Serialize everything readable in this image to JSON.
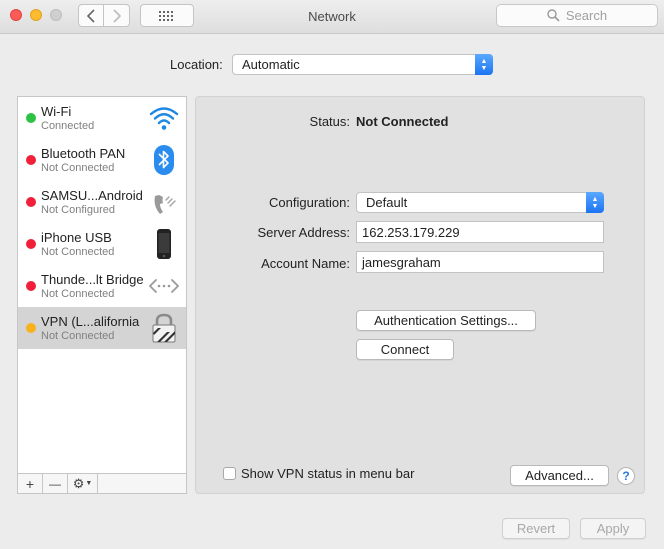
{
  "window": {
    "title": "Network"
  },
  "toolbar": {
    "search_placeholder": "Search"
  },
  "location": {
    "label": "Location:",
    "value": "Automatic"
  },
  "services": [
    {
      "name": "Wi-Fi",
      "status": "Connected",
      "dot_color": "#2ec245",
      "icon": "wifi-icon"
    },
    {
      "name": "Bluetooth PAN",
      "status": "Not Connected",
      "dot_color": "#f0203a",
      "icon": "bluetooth-icon"
    },
    {
      "name": "SAMSU...Android",
      "status": "Not Configured",
      "dot_color": "#f0203a",
      "icon": "phone-signal-icon"
    },
    {
      "name": "iPhone USB",
      "status": "Not Connected",
      "dot_color": "#f0203a",
      "icon": "iphone-icon"
    },
    {
      "name": "Thunde...lt Bridge",
      "status": "Not Connected",
      "dot_color": "#f0203a",
      "icon": "thunderbolt-bridge-icon"
    },
    {
      "name": "VPN (L...alifornia",
      "status": "Not Connected",
      "dot_color": "#f9b21d",
      "icon": "lock-icon",
      "selected": true
    }
  ],
  "sidebar_toolbar": {
    "add": "+",
    "remove": "—",
    "action": "⚙"
  },
  "detail": {
    "status_label": "Status:",
    "status_value": "Not Connected",
    "configuration_label": "Configuration:",
    "configuration_value": "Default",
    "server_label": "Server Address:",
    "server_value": "162.253.179.229",
    "account_label": "Account Name:",
    "account_value": "jamesgraham",
    "auth_button": "Authentication Settings...",
    "connect_button": "Connect",
    "show_vpn_label": "Show VPN status in menu bar",
    "show_vpn_checked": false,
    "advanced_button": "Advanced...",
    "help_button": "?"
  },
  "footer": {
    "revert": "Revert",
    "apply": "Apply"
  }
}
